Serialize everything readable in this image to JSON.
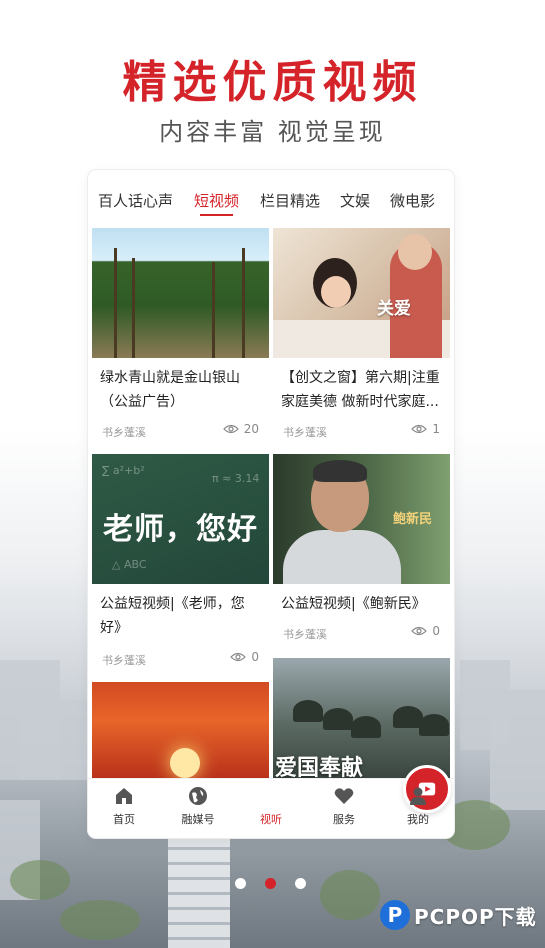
{
  "headline": "精选优质视频",
  "subline": "内容丰富 视觉呈现",
  "tabs": [
    {
      "label": "百人话心声",
      "active": false
    },
    {
      "label": "短视频",
      "active": true
    },
    {
      "label": "栏目精选",
      "active": false
    },
    {
      "label": "文娱",
      "active": false
    },
    {
      "label": "微电影",
      "active": false
    }
  ],
  "videos": [
    {
      "title": "绿水青山就是金山银山（公益广告）",
      "source": "书乡蓬溪",
      "views": "20",
      "thumb": "forest"
    },
    {
      "title": "【创文之窗】第六期|注重家庭美德 做新时代家庭...",
      "source": "书乡蓬溪",
      "views": "1",
      "thumb": "family",
      "overlay": "关爱"
    },
    {
      "title": "公益短视频|《老师，您好》",
      "source": "书乡蓬溪",
      "views": "0",
      "thumb": "chalkboard",
      "overlay": "老师，您好"
    },
    {
      "title": "公益短视频|《鲍新民》",
      "source": "书乡蓬溪",
      "views": "0",
      "thumb": "portrait",
      "overlay": "鲍新民"
    },
    {
      "title": "",
      "source": "",
      "views": "",
      "thumb": "sunset"
    },
    {
      "title": "",
      "source": "",
      "views": "",
      "thumb": "soldiers",
      "overlay": "爱国奉献"
    }
  ],
  "bottom_nav": [
    {
      "label": "首页",
      "icon": "home-icon",
      "active": false
    },
    {
      "label": "融媒号",
      "icon": "globe-icon",
      "active": false
    },
    {
      "label": "视听",
      "icon": "video-play-icon",
      "active": true
    },
    {
      "label": "服务",
      "icon": "heart-icon",
      "active": false
    },
    {
      "label": "我的",
      "icon": "person-icon",
      "active": false
    }
  ],
  "pager": {
    "count": 3,
    "active_index": 1
  },
  "watermark": {
    "text": "PCPOP下载"
  },
  "colors": {
    "accent": "#d4242a",
    "text": "#222222",
    "muted": "#999999"
  }
}
